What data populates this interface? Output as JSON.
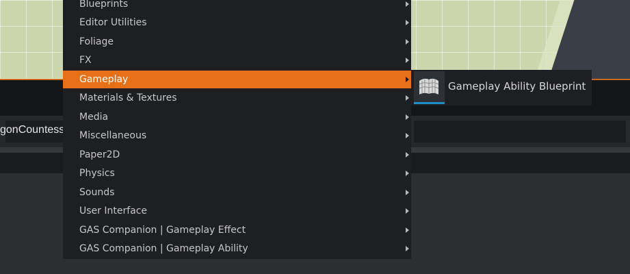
{
  "background": {
    "asset_name": "gonCountess"
  },
  "menu": {
    "items": [
      {
        "label": "Blueprints"
      },
      {
        "label": "Editor Utilities"
      },
      {
        "label": "Foliage"
      },
      {
        "label": "FX"
      },
      {
        "label": "Gameplay"
      },
      {
        "label": "Materials & Textures"
      },
      {
        "label": "Media"
      },
      {
        "label": "Miscellaneous"
      },
      {
        "label": "Paper2D"
      },
      {
        "label": "Physics"
      },
      {
        "label": "Sounds"
      },
      {
        "label": "User Interface"
      },
      {
        "label": "GAS Companion | Gameplay Effect"
      },
      {
        "label": "GAS Companion | Gameplay Ability"
      }
    ],
    "active_item": "Gameplay"
  },
  "submenu": {
    "items": [
      {
        "label": "Gameplay Ability Blueprint",
        "icon": "blueprint-grid-icon"
      }
    ]
  },
  "colors": {
    "highlight": "#e67016",
    "menu_bg": "#1d1f22",
    "icon_underline": "#1e8fc8"
  }
}
